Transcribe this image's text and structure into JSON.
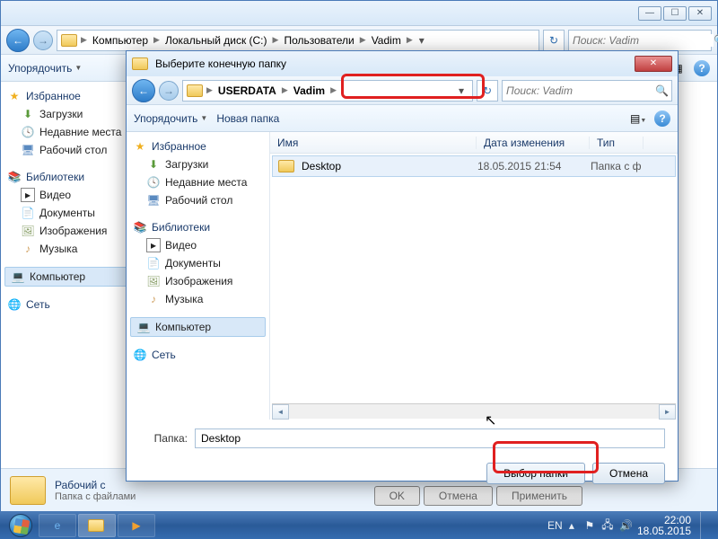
{
  "main_window": {
    "breadcrumb": [
      "Компьютер",
      "Локальный диск (C:)",
      "Пользователи",
      "Vadim"
    ],
    "search_placeholder": "Поиск: Vadim",
    "toolbar": {
      "organize": "Упорядочить"
    },
    "sidebar": {
      "favorites": {
        "head": "Избранное",
        "items": [
          "Загрузки",
          "Недавние места",
          "Рабочий стол"
        ]
      },
      "libraries": {
        "head": "Библиотеки",
        "items": [
          "Видео",
          "Документы",
          "Изображения",
          "Музыка"
        ]
      },
      "computer": "Компьютер",
      "network": "Сеть"
    },
    "status": {
      "title": "Рабочий с",
      "sub": "Папка с файлами"
    },
    "buttons": {
      "ok": "OK",
      "cancel": "Отмена",
      "apply": "Применить"
    }
  },
  "dialog": {
    "title": "Выберите конечную папку",
    "breadcrumb": [
      "USERDATA",
      "Vadim"
    ],
    "search_placeholder": "Поиск: Vadim",
    "toolbar": {
      "organize": "Упорядочить",
      "new_folder": "Новая папка"
    },
    "sidebar": {
      "favorites": {
        "head": "Избранное",
        "items": [
          "Загрузки",
          "Недавние места",
          "Рабочий стол"
        ]
      },
      "libraries": {
        "head": "Библиотеки",
        "items": [
          "Видео",
          "Документы",
          "Изображения",
          "Музыка"
        ]
      },
      "computer": "Компьютер",
      "network": "Сеть"
    },
    "columns": {
      "name": "Имя",
      "date": "Дата изменения",
      "type": "Тип"
    },
    "row": {
      "name": "Desktop",
      "date": "18.05.2015 21:54",
      "type": "Папка с ф"
    },
    "folder_label": "Папка:",
    "folder_value": "Desktop",
    "btn_select": "Выбор папки",
    "btn_cancel": "Отмена"
  },
  "taskbar": {
    "lang": "EN",
    "time": "22:00",
    "date": "18.05.2015"
  }
}
